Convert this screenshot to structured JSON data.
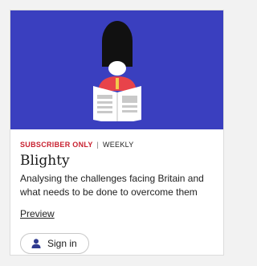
{
  "card": {
    "badge": "SUBSCRIBER ONLY",
    "separator": "|",
    "frequency": "WEEKLY",
    "title": "Blighty",
    "description": "Analysing the challenges facing Britain and what needs to be done to overcome them",
    "preview_label": "Preview",
    "signin_label": "Sign in"
  },
  "colors": {
    "hero_background": "#3a3fbf",
    "badge": "#c8202f",
    "guard_tunic": "#e8434a",
    "bearskin": "#111111",
    "icon": "#2f3a8f"
  },
  "icons": {
    "hero": "royal-guard-reading-newspaper-illustration",
    "signin": "person-icon"
  }
}
